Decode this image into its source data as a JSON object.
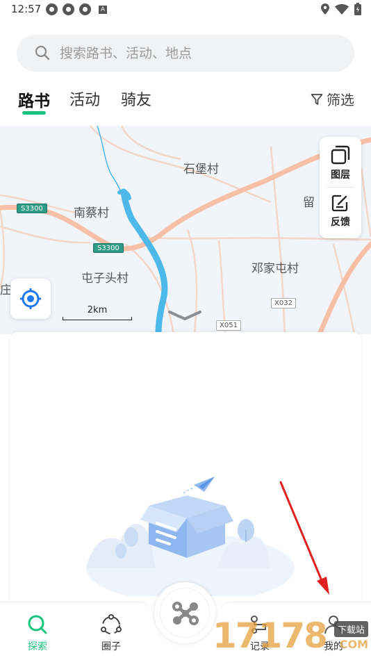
{
  "status_bar": {
    "time": "12:57",
    "icons_left": [
      "app-icon",
      "app-icon",
      "app-icon",
      "a-icon"
    ],
    "icons_right": [
      "location-icon",
      "wifi-icon",
      "battery-icon"
    ]
  },
  "search": {
    "placeholder": "搜索路书、活动、地点"
  },
  "tabs": [
    {
      "label": "路书",
      "active": true
    },
    {
      "label": "活动",
      "active": false
    },
    {
      "label": "骑友",
      "active": false
    }
  ],
  "filter": {
    "label": "筛选"
  },
  "map": {
    "places": [
      "石堡村",
      "南蔡村",
      "屯子头村",
      "邓家屯村",
      "留",
      "庄"
    ],
    "roads": [
      "S3300",
      "S3300",
      "X032",
      "X051"
    ],
    "scale": "2km",
    "tools": [
      {
        "label": "图层",
        "icon": "layers-icon"
      },
      {
        "label": "反馈",
        "icon": "feedback-icon"
      }
    ]
  },
  "bottom_nav": {
    "items": [
      {
        "label": "探索",
        "icon": "search-icon",
        "active": true
      },
      {
        "label": "圈子",
        "icon": "circle-icon",
        "active": false
      },
      {
        "label": "记录",
        "icon": "route-icon",
        "active": false
      },
      {
        "label": "我的",
        "icon": "user-icon",
        "active": false
      }
    ],
    "center_icon": "ride-hub-icon"
  },
  "watermark": {
    "digits": "17178",
    "tag": "下载站",
    "suffix": "COM"
  },
  "colors": {
    "accent": "#19c37d",
    "road": "#f7c8b2",
    "river": "#4db8ea",
    "arrow": "#e02020"
  }
}
